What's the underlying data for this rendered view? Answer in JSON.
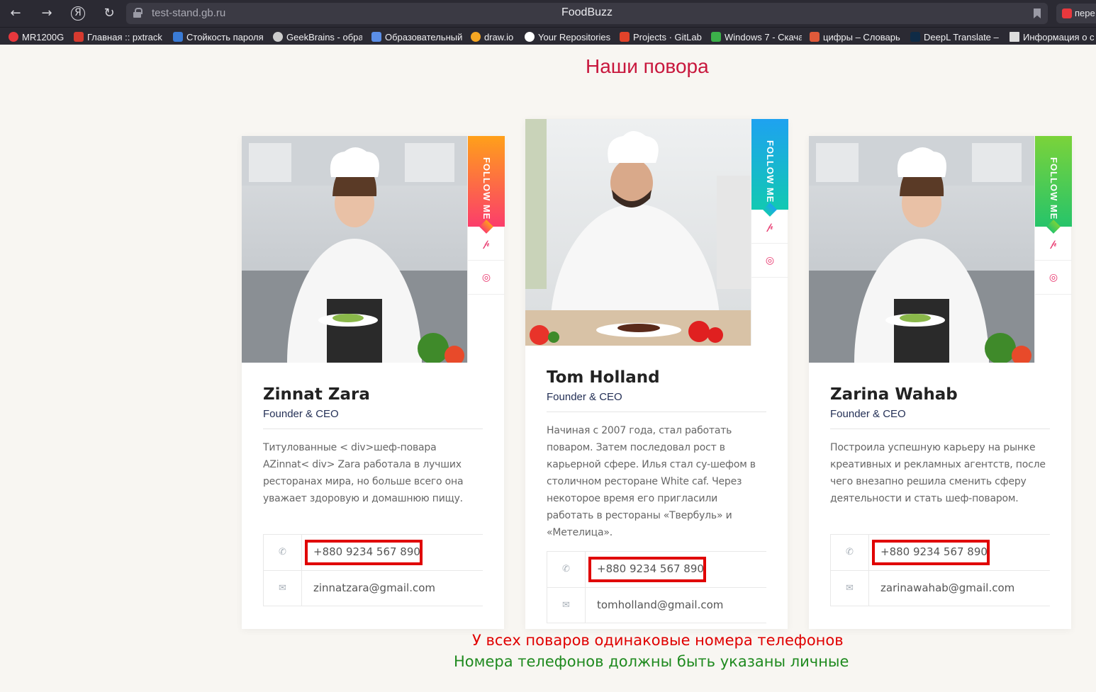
{
  "browser": {
    "url": "test-stand.gb.ru",
    "title": "FoodBuzz",
    "ext_tab": "пере",
    "bookmarks": [
      {
        "label": "MR1200G",
        "icon": "mr-icon",
        "color": "#e8383d"
      },
      {
        "label": "Главная :: pxtrack",
        "icon": "pxtrack-icon",
        "color": "#d63a2f"
      },
      {
        "label": "Стойкость пароля",
        "icon": "ip-icon",
        "color": "#3a7bd5"
      },
      {
        "label": "GeekBrains - обра",
        "icon": "geekbrains-icon",
        "color": "#cccccc"
      },
      {
        "label": "Образовательный",
        "icon": "edu-icon",
        "color": "#5b8ee6"
      },
      {
        "label": "draw.io",
        "icon": "drawio-icon",
        "color": "#f5a623"
      },
      {
        "label": "Your Repositories",
        "icon": "github-icon",
        "color": "#ffffff"
      },
      {
        "label": "Projects · GitLab",
        "icon": "gitlab-icon",
        "color": "#e2432a"
      },
      {
        "label": "Windows 7 - Скача",
        "icon": "windows-icon",
        "color": "#3cb04a"
      },
      {
        "label": "цифры – Словарь",
        "icon": "dictionary-icon",
        "color": "#e05a3a"
      },
      {
        "label": "DeepL Translate –",
        "icon": "deepl-icon",
        "color": "#0f2b46"
      },
      {
        "label": "Информация о с",
        "icon": "page-icon",
        "color": "#dddddd"
      }
    ]
  },
  "section": {
    "title": "Наши повора"
  },
  "follow_label": "FOLLOW ME",
  "chefs": [
    {
      "name": "Zinnat Zara",
      "role": "Founder & CEO",
      "bio": "Титулованные < div>шеф-повара AZinnat< div> Zara работала в лучших ресторанах мира, но больше всего она уважает здоровую и домашнюю пищу.",
      "phone": "+880 9234 567 890",
      "email": "zinnatzara@gmail.com",
      "accent": "#fb3d6b"
    },
    {
      "name": "Tom Holland",
      "role": "Founder & CEO",
      "bio": "Начиная с 2007 года, стал работать поваром. Затем последовал рост в карьерной сфере. Илья стал су-шефом в столичном ресторане White caf. Через некоторое время его пригласили работать в рестораны «Твербуль» и «Метелица».",
      "phone": "+880 9234 567 890",
      "email": "tomholland@gmail.com",
      "accent": "#12c9b2"
    },
    {
      "name": "Zarina Wahab",
      "role": "Founder & CEO",
      "bio": "Построила успешную карьеру на рынке креативных и рекламных агентств, после чего внезапно решила сменить сферу деятельности и стать шеф-поваром.",
      "phone": "+880 9234 567 890",
      "email": "zarinawahab@gmail.com",
      "accent": "#26c46a"
    }
  ],
  "annotations": {
    "line1": "У всех поваров одинаковые номера телефонов",
    "line2": "Номера телефонов должны быть указаны личные"
  }
}
